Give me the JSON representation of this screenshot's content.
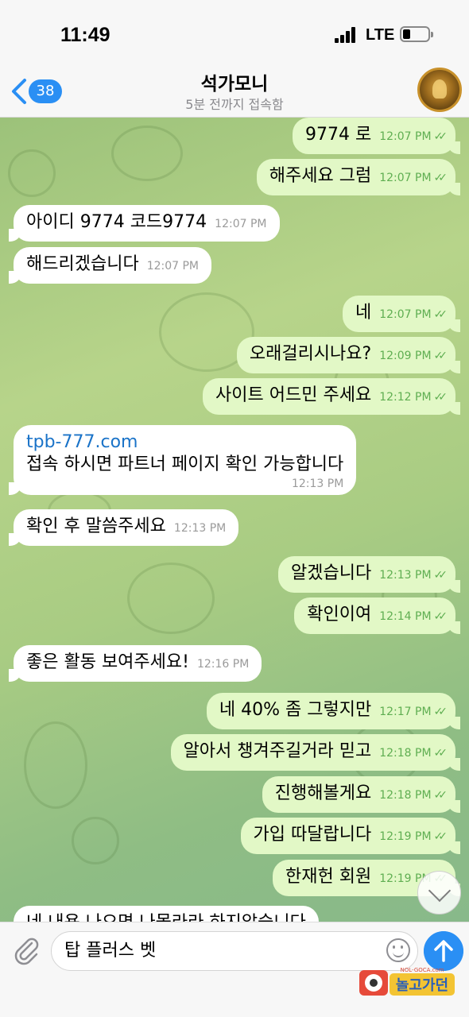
{
  "status_bar": {
    "time": "11:49",
    "network": "LTE"
  },
  "header": {
    "back_count": "38",
    "title": "석가모니",
    "subtitle": "5분 전까지 접속함"
  },
  "messages": [
    {
      "dir": "out",
      "text": "9774 로",
      "time": "12:07 PM"
    },
    {
      "dir": "out",
      "text": "해주세요 그럼",
      "time": "12:07 PM"
    },
    {
      "dir": "in",
      "text": "아이디 9774  코드9774",
      "time": "12:07 PM"
    },
    {
      "dir": "in",
      "text": "해드리겠습니다",
      "time": "12:07 PM"
    },
    {
      "dir": "out",
      "text": "네",
      "time": "12:07 PM"
    },
    {
      "dir": "out",
      "text": "오래걸리시나요?",
      "time": "12:09 PM"
    },
    {
      "dir": "out",
      "text": "사이트 어드민 주세요",
      "time": "12:12 PM"
    },
    {
      "dir": "in",
      "link": "tpb-777.com",
      "text": "접속 하시면 파트너 페이지 확인 가능합니다",
      "time": "12:13 PM"
    },
    {
      "dir": "in",
      "text": "확인 후 말씀주세요",
      "time": "12:13 PM"
    },
    {
      "dir": "out",
      "text": "알겠습니다",
      "time": "12:13 PM"
    },
    {
      "dir": "out",
      "text": "확인이여",
      "time": "12:14 PM"
    },
    {
      "dir": "in",
      "text": "좋은 활동 보여주세요!",
      "time": "12:16 PM"
    },
    {
      "dir": "out",
      "text": "네 40% 좀 그렇지만",
      "time": "12:17 PM"
    },
    {
      "dir": "out",
      "text": "알아서 챙겨주길거라 믿고",
      "time": "12:18 PM"
    },
    {
      "dir": "out",
      "text": "진행해볼게요",
      "time": "12:18 PM"
    },
    {
      "dir": "out",
      "text": "가입 따달랍니다",
      "time": "12:19 PM"
    },
    {
      "dir": "out",
      "text": "한재헌 회원",
      "time": "12:19 PM"
    },
    {
      "dir": "in",
      "text": "네 내용 나오면 나몰라라 하지않습니다",
      "time": ""
    }
  ],
  "composer": {
    "text": "탑 플러스 벳"
  },
  "watermark": {
    "text": "놀고가던",
    "small": "NOL-GOCA.com"
  },
  "colors": {
    "accent": "#2a8ff4",
    "outgoing": "#e2f8c6",
    "incoming": "#ffffff",
    "check": "#5fae51"
  }
}
